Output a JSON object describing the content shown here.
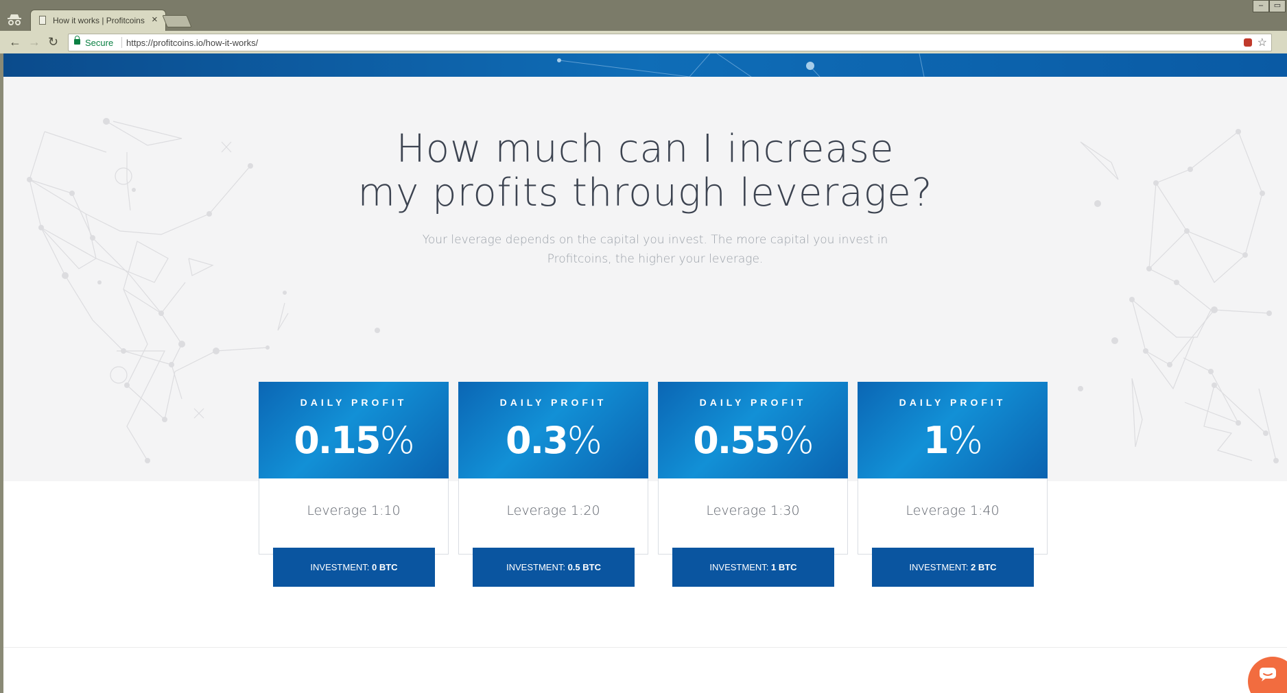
{
  "browser": {
    "tab_title": "How it works | Profitcoins",
    "tab_close": "×",
    "security_label": "Secure",
    "url": "https://profitcoins.io/how-it-works/",
    "window_minimize": "–",
    "window_maximize": "▭"
  },
  "hero": {
    "headline_line1": "How much can I increase",
    "headline_line2": "my profits through leverage?",
    "subheading": "Your leverage depends on the capital you invest. The more capital you invest in Profitcoins, the higher your leverage."
  },
  "plans": [
    {
      "label": "DAILY PROFIT",
      "profit": "0.15",
      "unit": "%",
      "leverage": "Leverage 1:10",
      "investment_label": "INVESTMENT: ",
      "investment_value": "0 BTC"
    },
    {
      "label": "DAILY PROFIT",
      "profit": "0.3",
      "unit": "%",
      "leverage": "Leverage 1:20",
      "investment_label": "INVESTMENT: ",
      "investment_value": "0.5 BTC"
    },
    {
      "label": "DAILY PROFIT",
      "profit": "0.55",
      "unit": "%",
      "leverage": "Leverage 1:30",
      "investment_label": "INVESTMENT: ",
      "investment_value": "1 BTC"
    },
    {
      "label": "DAILY PROFIT",
      "profit": "1",
      "unit": "%",
      "leverage": "Leverage 1:40",
      "investment_label": "INVESTMENT: ",
      "investment_value": "2 BTC"
    }
  ],
  "colors": {
    "brand_blue": "#0b66b4",
    "button_blue": "#0a55a0",
    "chat_orange": "#f26c3f"
  },
  "icons": [
    "incognito-icon",
    "page-icon",
    "back-icon",
    "forward-icon",
    "reload-icon",
    "lock-icon",
    "extension-icon",
    "star-icon",
    "chat-icon"
  ]
}
